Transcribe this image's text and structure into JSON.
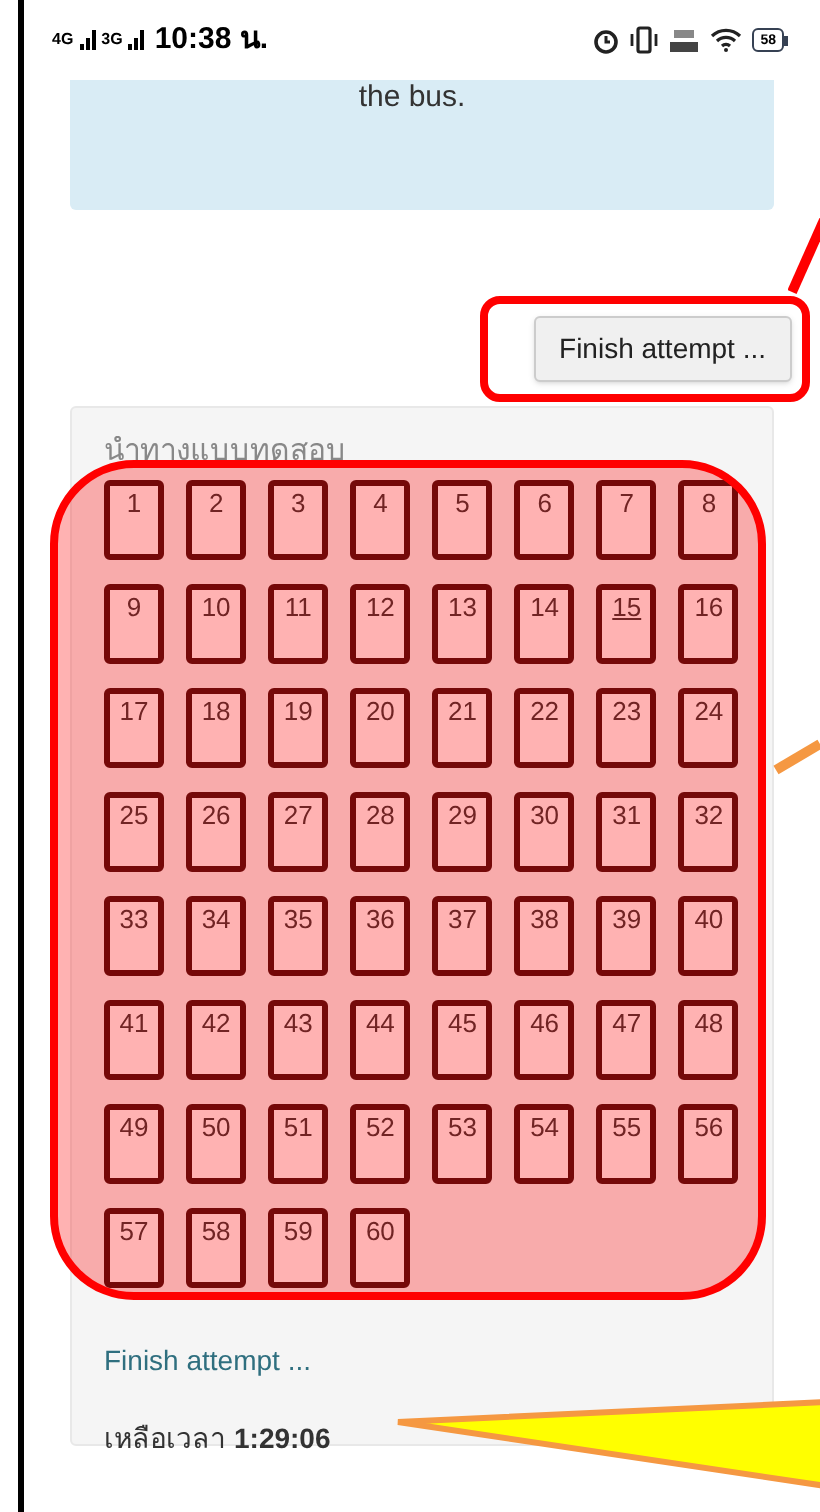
{
  "status_bar": {
    "signal_1": "4G",
    "signal_2": "3G",
    "time": "10:38 น.",
    "battery": "58"
  },
  "feedback": {
    "text": "the bus."
  },
  "finish_button": {
    "label": "Finish attempt ..."
  },
  "quiz_navigation": {
    "title": "นำทางแบบทดสอบ",
    "questions": [
      {
        "number": "1",
        "current": false
      },
      {
        "number": "2",
        "current": false
      },
      {
        "number": "3",
        "current": false
      },
      {
        "number": "4",
        "current": false
      },
      {
        "number": "5",
        "current": false
      },
      {
        "number": "6",
        "current": false
      },
      {
        "number": "7",
        "current": false
      },
      {
        "number": "8",
        "current": false
      },
      {
        "number": "9",
        "current": false
      },
      {
        "number": "10",
        "current": false
      },
      {
        "number": "11",
        "current": false
      },
      {
        "number": "12",
        "current": false
      },
      {
        "number": "13",
        "current": false
      },
      {
        "number": "14",
        "current": false
      },
      {
        "number": "15",
        "current": true
      },
      {
        "number": "16",
        "current": false
      },
      {
        "number": "17",
        "current": false
      },
      {
        "number": "18",
        "current": false
      },
      {
        "number": "19",
        "current": false
      },
      {
        "number": "20",
        "current": false
      },
      {
        "number": "21",
        "current": false
      },
      {
        "number": "22",
        "current": false
      },
      {
        "number": "23",
        "current": false
      },
      {
        "number": "24",
        "current": false
      },
      {
        "number": "25",
        "current": false
      },
      {
        "number": "26",
        "current": false
      },
      {
        "number": "27",
        "current": false
      },
      {
        "number": "28",
        "current": false
      },
      {
        "number": "29",
        "current": false
      },
      {
        "number": "30",
        "current": false
      },
      {
        "number": "31",
        "current": false
      },
      {
        "number": "32",
        "current": false
      },
      {
        "number": "33",
        "current": false
      },
      {
        "number": "34",
        "current": false
      },
      {
        "number": "35",
        "current": false
      },
      {
        "number": "36",
        "current": false
      },
      {
        "number": "37",
        "current": false
      },
      {
        "number": "38",
        "current": false
      },
      {
        "number": "39",
        "current": false
      },
      {
        "number": "40",
        "current": false
      },
      {
        "number": "41",
        "current": false
      },
      {
        "number": "42",
        "current": false
      },
      {
        "number": "43",
        "current": false
      },
      {
        "number": "44",
        "current": false
      },
      {
        "number": "45",
        "current": false
      },
      {
        "number": "46",
        "current": false
      },
      {
        "number": "47",
        "current": false
      },
      {
        "number": "48",
        "current": false
      },
      {
        "number": "49",
        "current": false
      },
      {
        "number": "50",
        "current": false
      },
      {
        "number": "51",
        "current": false
      },
      {
        "number": "52",
        "current": false
      },
      {
        "number": "53",
        "current": false
      },
      {
        "number": "54",
        "current": false
      },
      {
        "number": "55",
        "current": false
      },
      {
        "number": "56",
        "current": false
      },
      {
        "number": "57",
        "current": false
      },
      {
        "number": "58",
        "current": false
      },
      {
        "number": "59",
        "current": false
      },
      {
        "number": "60",
        "current": false
      }
    ],
    "finish_link": "Finish attempt ...",
    "time_left_label": "เหลือเวลา",
    "time_left": "1:29:06"
  }
}
